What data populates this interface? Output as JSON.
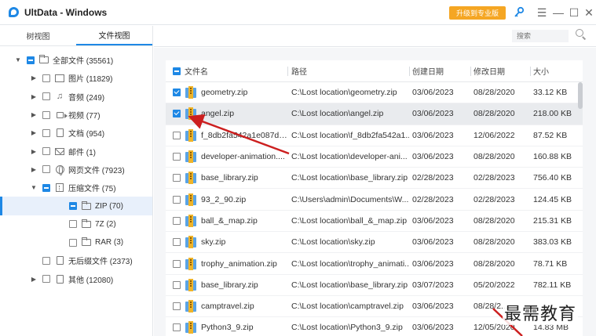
{
  "window": {
    "title": "UltData - Windows",
    "upgrade_label": "升级到专业版",
    "menu_glyph": "☰",
    "min_glyph": "—",
    "max_glyph": "☐",
    "close_glyph": "✕"
  },
  "view_tabs": [
    {
      "label": "树视图",
      "active": false
    },
    {
      "label": "文件视图",
      "active": true
    }
  ],
  "tree": [
    {
      "label": "全部文件 (35561)",
      "level": 0,
      "arrow": "▼",
      "check": "partial",
      "icon": "folder-outline-icon"
    },
    {
      "label": "图片 (11829)",
      "level": 1,
      "arrow": "▶",
      "check": "none",
      "icon": "image-icon"
    },
    {
      "label": "音频 (249)",
      "level": 1,
      "arrow": "▶",
      "check": "none",
      "icon": "music-icon"
    },
    {
      "label": "视频 (77)",
      "level": 1,
      "arrow": "▶",
      "check": "none",
      "icon": "video-icon"
    },
    {
      "label": "文档 (954)",
      "level": 1,
      "arrow": "▶",
      "check": "none",
      "icon": "document-icon"
    },
    {
      "label": "邮件 (1)",
      "level": 1,
      "arrow": "▶",
      "check": "none",
      "icon": "mail-icon"
    },
    {
      "label": "网页文件 (7923)",
      "level": 1,
      "arrow": "▶",
      "check": "none",
      "icon": "globe-icon"
    },
    {
      "label": "压缩文件 (75)",
      "level": 1,
      "arrow": "▼",
      "check": "partial",
      "icon": "archive-icon"
    },
    {
      "label": "ZIP (70)",
      "level": 2,
      "arrow": "",
      "check": "partial",
      "icon": "folder-outline-icon",
      "selected": true
    },
    {
      "label": "7Z (2)",
      "level": 2,
      "arrow": "",
      "check": "none",
      "icon": "folder-outline-icon"
    },
    {
      "label": "RAR (3)",
      "level": 2,
      "arrow": "",
      "check": "none",
      "icon": "folder-outline-icon"
    },
    {
      "label": "无后缀文件 (2373)",
      "level": 1,
      "arrow": "",
      "check": "none",
      "icon": "document-icon"
    },
    {
      "label": "其他 (12080)",
      "level": 1,
      "arrow": "▶",
      "check": "none",
      "icon": "document-icon"
    }
  ],
  "search": {
    "placeholder": "搜索"
  },
  "table": {
    "headers": {
      "name": "文件名",
      "path": "路径",
      "created": "创建日期",
      "modified": "修改日期",
      "size": "大小"
    },
    "rows": [
      {
        "name": "geometry.zip",
        "path": "C:\\Lost location\\geometry.zip",
        "created": "03/06/2023",
        "modified": "08/28/2020",
        "size": "33.12 KB",
        "checked": true,
        "highlight": false
      },
      {
        "name": "angel.zip",
        "path": "C:\\Lost location\\angel.zip",
        "created": "03/06/2023",
        "modified": "08/28/2020",
        "size": "218.00 KB",
        "checked": true,
        "highlight": true
      },
      {
        "name": "f_8db2fa542a1e087d6...",
        "path": "C:\\Lost location\\f_8db2fa542a1...",
        "created": "03/06/2023",
        "modified": "12/06/2022",
        "size": "87.52 KB",
        "checked": false,
        "highlight": false
      },
      {
        "name": "developer-animation....",
        "path": "C:\\Lost location\\developer-ani...",
        "created": "03/06/2023",
        "modified": "08/28/2020",
        "size": "160.88 KB",
        "checked": false,
        "highlight": false
      },
      {
        "name": "base_library.zip",
        "path": "C:\\Lost location\\base_library.zip",
        "created": "02/28/2023",
        "modified": "02/28/2023",
        "size": "756.40 KB",
        "checked": false,
        "highlight": false
      },
      {
        "name": "93_2_90.zip",
        "path": "C:\\Users\\admin\\Documents\\W...",
        "created": "02/28/2023",
        "modified": "02/28/2023",
        "size": "124.45 KB",
        "checked": false,
        "highlight": false
      },
      {
        "name": "ball_&_map.zip",
        "path": "C:\\Lost location\\ball_&_map.zip",
        "created": "03/06/2023",
        "modified": "08/28/2020",
        "size": "215.31 KB",
        "checked": false,
        "highlight": false
      },
      {
        "name": "sky.zip",
        "path": "C:\\Lost location\\sky.zip",
        "created": "03/06/2023",
        "modified": "08/28/2020",
        "size": "383.03 KB",
        "checked": false,
        "highlight": false
      },
      {
        "name": "trophy_animation.zip",
        "path": "C:\\Lost location\\trophy_animati...",
        "created": "03/06/2023",
        "modified": "08/28/2020",
        "size": "78.71 KB",
        "checked": false,
        "highlight": false
      },
      {
        "name": "base_library.zip",
        "path": "C:\\Lost location\\base_library.zip",
        "created": "03/07/2023",
        "modified": "05/20/2022",
        "size": "782.11 KB",
        "checked": false,
        "highlight": false
      },
      {
        "name": "camptravel.zip",
        "path": "C:\\Lost location\\camptravel.zip",
        "created": "03/06/2023",
        "modified": "08/28/2...",
        "size": "",
        "checked": false,
        "highlight": false
      },
      {
        "name": "Python3_9.zip",
        "path": "C:\\Lost location\\Python3_9.zip",
        "created": "03/06/2023",
        "modified": "12/05/2020",
        "size": "14.83 MB",
        "checked": false,
        "highlight": false
      }
    ]
  },
  "watermark": "最需教育",
  "colors": {
    "accent": "#1e88e5",
    "upgrade": "#f5a623",
    "arrow": "#cc1f1f"
  }
}
